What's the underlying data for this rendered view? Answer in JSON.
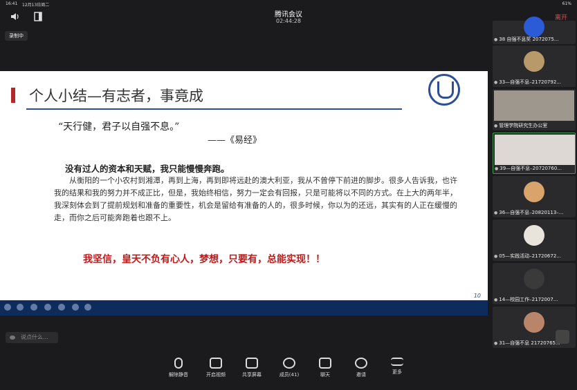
{
  "status": {
    "time": "16:41",
    "date": "12月13日周二",
    "battery": "61%"
  },
  "header": {
    "title": "腾讯会议",
    "timer": "02:44:28",
    "leave": "离开"
  },
  "recording": "录制中",
  "slide": {
    "title": "个人小结—有志者，事竟成",
    "quote": "“天行健，君子以自强不息。”",
    "source": "——《易经》",
    "bold_line": "没有过人的资本和天赋，我只能慢慢奔跑。",
    "paragraph": "从衡阳的一个小农村到湘潭，再到上海，再到即将远赴的澳大利亚，我从不曾停下前进的脚步。很多人告诉我，也许我的结果和我的努力并不成正比，但是，我始终相信，努力一定会有回报，只是可能将以不同的方式。在上大的两年半，我深刻体会到了提前规划和准备的重要性，机会是留给有准备的人的，很多时候，你以为的还远，其实有的人正在缓慢的走，而你之后可能奔跑着也跟不上。",
    "red_line": "我坚信，皇天不负有心人，梦想，只要有，总能实现！！",
    "page": "10"
  },
  "chat_placeholder": "说点什么...",
  "participants": [
    {
      "label": "38 自强不息奖 2072075..."
    },
    {
      "label": "33—自强不息–21720792..."
    },
    {
      "label": "管理学院研究生办公室"
    },
    {
      "label": "39—自强不息–20720760..."
    },
    {
      "label": "36—自强不息–20820113–..."
    },
    {
      "label": "05—实践活动–21720672..."
    },
    {
      "label": "14—校园工作–2172007..."
    },
    {
      "label": "31—自强不息 21720765..."
    }
  ],
  "toolbar": [
    {
      "label": "解除静音"
    },
    {
      "label": "开启视频"
    },
    {
      "label": "共享屏幕"
    },
    {
      "label": "成员(41)"
    },
    {
      "label": "聊天"
    },
    {
      "label": "邀请"
    },
    {
      "label": "更多"
    }
  ]
}
